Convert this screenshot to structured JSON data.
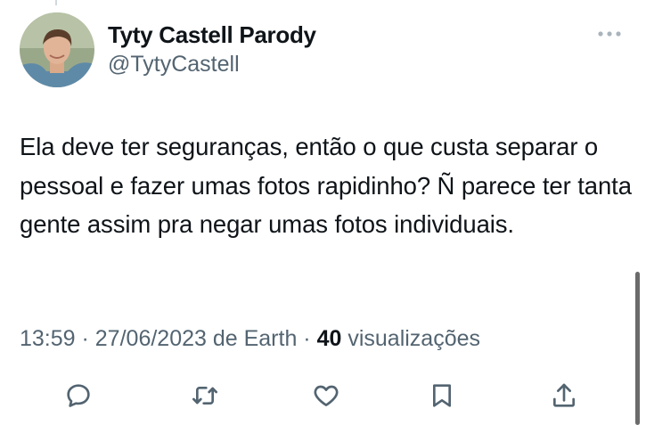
{
  "author": {
    "display_name": "Tyty Castell Parody",
    "handle": "@TytyCastell",
    "avatar_icon": "profile-photo-avatar"
  },
  "more_icon": "more-horizontal-icon",
  "tweet": {
    "text": "Ela deve ter seguranças, então o que custa separar o pessoal e fazer umas fotos rapidinho? Ñ parece ter tanta gente assim pra negar umas fotos individuais."
  },
  "meta": {
    "time": "13:59",
    "separator1": " · ",
    "date": "27/06/2023",
    "location": " de Earth",
    "separator2": " · ",
    "views_count": "40",
    "views_label": " visualizações"
  },
  "actions": [
    {
      "name": "reply",
      "icon": "reply-icon"
    },
    {
      "name": "retweet",
      "icon": "retweet-icon"
    },
    {
      "name": "like",
      "icon": "heart-icon"
    },
    {
      "name": "bookmark",
      "icon": "bookmark-icon"
    },
    {
      "name": "share",
      "icon": "share-icon"
    }
  ],
  "colors": {
    "text_primary": "#0f1419",
    "text_secondary": "#536471",
    "icon": "#536471"
  }
}
